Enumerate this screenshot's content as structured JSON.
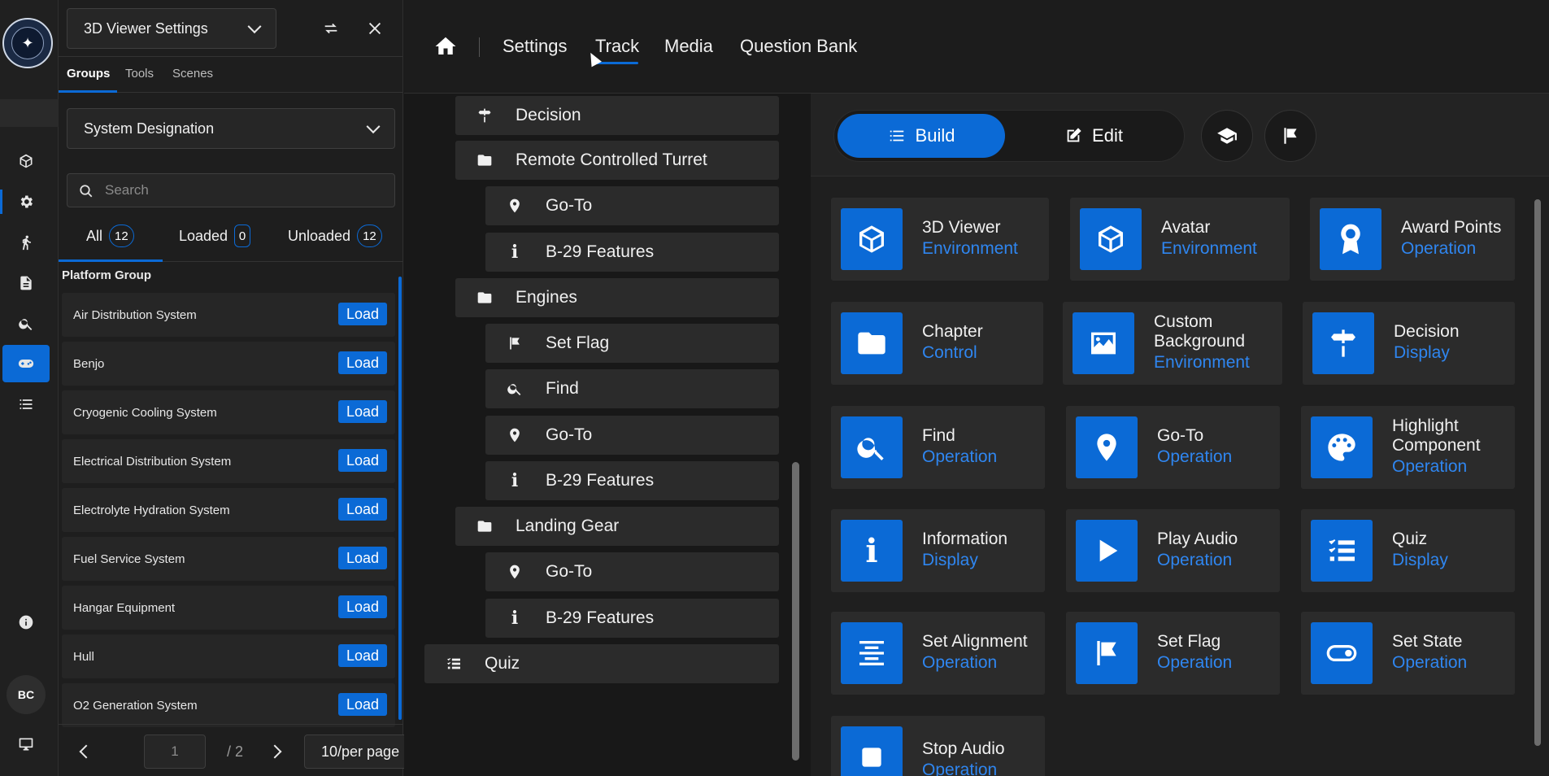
{
  "panel": {
    "viewer_select": "3D Viewer Settings",
    "subtabs": [
      "Groups",
      "Tools",
      "Scenes"
    ],
    "designation_select": "System Designation",
    "search_placeholder": "Search",
    "filters": [
      {
        "label": "All",
        "count": "12"
      },
      {
        "label": "Loaded",
        "count": "0"
      },
      {
        "label": "Unloaded",
        "count": "12"
      }
    ],
    "group_title": "Platform Group",
    "load_label": "Load",
    "items": [
      "Air Distribution System",
      "Benjo",
      "Cryogenic Cooling System",
      "Electrical Distribution System",
      "Electrolyte Hydration System",
      "Fuel Service System",
      "Hangar Equipment",
      "Hull",
      "O2 Generation System"
    ],
    "pager": {
      "page": "1",
      "total": "/ 2",
      "per_page": "10/per page"
    }
  },
  "rail": {
    "avatar_initials": "BC"
  },
  "nav": {
    "items": [
      "Settings",
      "Track",
      "Media",
      "Question Bank"
    ],
    "active": "Track"
  },
  "tree": [
    {
      "label": "Decision",
      "icon": "signpost-icon"
    },
    {
      "label": "Remote Controlled Turret",
      "icon": "folder-icon"
    },
    {
      "label": "Go-To",
      "icon": "location-pin-icon"
    },
    {
      "label": "B-29 Features",
      "icon": "info-icon"
    },
    {
      "label": "Engines",
      "icon": "folder-icon"
    },
    {
      "label": "Set Flag",
      "icon": "flag-icon"
    },
    {
      "label": "Find",
      "icon": "search-icon"
    },
    {
      "label": "Go-To",
      "icon": "location-pin-icon"
    },
    {
      "label": "B-29 Features",
      "icon": "info-icon"
    },
    {
      "label": "Landing Gear",
      "icon": "folder-icon"
    },
    {
      "label": "Go-To",
      "icon": "location-pin-icon"
    },
    {
      "label": "B-29 Features",
      "icon": "info-icon"
    },
    {
      "label": "Quiz",
      "icon": "checklist-icon"
    }
  ],
  "workspace": {
    "build_label": "Build",
    "edit_label": "Edit",
    "cards": [
      {
        "name": "3D Viewer",
        "category": "Environment",
        "icon": "cube-icon"
      },
      {
        "name": "Avatar",
        "category": "Environment",
        "icon": "cube-icon"
      },
      {
        "name": "Award Points",
        "category": "Operation",
        "icon": "award-icon"
      },
      {
        "name": "Chapter",
        "category": "Control",
        "icon": "folder-icon"
      },
      {
        "name": "Custom Background",
        "category": "Environment",
        "icon": "image-icon"
      },
      {
        "name": "Decision",
        "category": "Display",
        "icon": "signpost-icon"
      },
      {
        "name": "Find",
        "category": "Operation",
        "icon": "search-icon"
      },
      {
        "name": "Go-To",
        "category": "Operation",
        "icon": "location-pin-icon"
      },
      {
        "name": "Highlight Component",
        "category": "Operation",
        "icon": "palette-icon"
      },
      {
        "name": "Information",
        "category": "Display",
        "icon": "info-icon"
      },
      {
        "name": "Play Audio",
        "category": "Operation",
        "icon": "play-icon"
      },
      {
        "name": "Quiz",
        "category": "Display",
        "icon": "checklist-icon"
      },
      {
        "name": "Set Alignment",
        "category": "Operation",
        "icon": "align-center-icon"
      },
      {
        "name": "Set Flag",
        "category": "Operation",
        "icon": "flag-icon"
      },
      {
        "name": "Set State",
        "category": "Operation",
        "icon": "toggle-icon"
      },
      {
        "name": "Stop Audio",
        "category": "Operation",
        "icon": "stop-icon"
      }
    ]
  },
  "colors": {
    "accent": "#0b6ad6",
    "category_text": "#2f86f0",
    "background": "#1a1a1a"
  }
}
